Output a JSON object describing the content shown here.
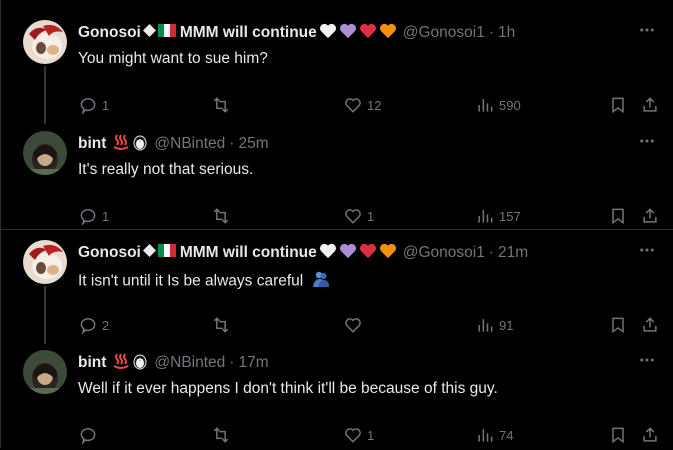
{
  "colors": {
    "background": "#000000",
    "text_primary": "#e7e9ea",
    "text_secondary": "#71767b",
    "divider": "#2f3336"
  },
  "tweets": [
    {
      "name": "Gonosoi",
      "name_emojis": [
        "diamond",
        "italy-flag"
      ],
      "name_suffix": "MMM will continue",
      "suffix_emojis": [
        "white-heart",
        "purple-heart",
        "red-heart",
        "orange-heart"
      ],
      "handle": "@Gonosoi1",
      "time": "1h",
      "text": "You might want to sue him?",
      "replies": "1",
      "reposts": "",
      "likes": "12",
      "views": "590"
    },
    {
      "name": "bint",
      "name_emojis": [
        "hot-springs",
        "penguin"
      ],
      "name_suffix": "",
      "suffix_emojis": [],
      "handle": "@NBinted",
      "time": "25m",
      "text": "It's really not that serious.",
      "replies": "1",
      "reposts": "",
      "likes": "1",
      "views": "157"
    },
    {
      "name": "Gonosoi",
      "name_emojis": [
        "diamond",
        "italy-flag"
      ],
      "name_suffix": "MMM will continue",
      "suffix_emojis": [
        "white-heart",
        "purple-heart",
        "red-heart",
        "orange-heart"
      ],
      "handle": "@Gonosoi1",
      "time": "21m",
      "text": "It isn't until it Is be always careful",
      "text_emoji": "hugging-people",
      "replies": "2",
      "reposts": "",
      "likes": "",
      "views": "91"
    },
    {
      "name": "bint",
      "name_emojis": [
        "hot-springs",
        "penguin"
      ],
      "name_suffix": "",
      "suffix_emojis": [],
      "handle": "@NBinted",
      "time": "17m",
      "text": "Well if it ever happens I don't think it'll be because of this guy.",
      "replies": "",
      "reposts": "",
      "likes": "1",
      "views": "74"
    }
  ]
}
